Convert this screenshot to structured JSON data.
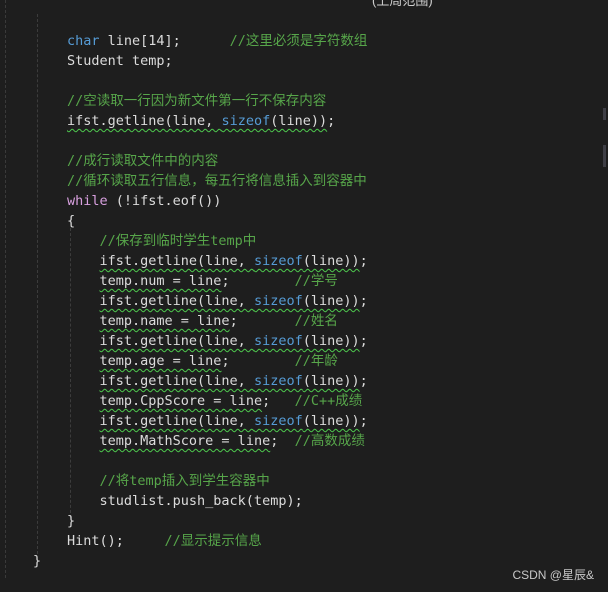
{
  "top_clipped_text": "(上周范围)",
  "code_lines": [
    {
      "t": [
        {
          "c": "kw",
          "s": "char"
        },
        {
          "c": "pl",
          "s": " line[14];      "
        },
        {
          "c": "cm",
          "s": "//这里必须是字符数组"
        }
      ]
    },
    {
      "t": [
        {
          "c": "pl",
          "s": "Student temp;"
        }
      ]
    },
    {
      "t": []
    },
    {
      "t": [
        {
          "c": "cm",
          "s": "//空读取一行因为新文件第一行不保存内容"
        }
      ]
    },
    {
      "t": [
        {
          "c": "pl sq",
          "s": "ifst.getline(line, "
        },
        {
          "c": "kw sq",
          "s": "sizeof"
        },
        {
          "c": "pl sq",
          "s": "(line))"
        },
        {
          "c": "pl",
          "s": ";"
        }
      ]
    },
    {
      "t": []
    },
    {
      "t": [
        {
          "c": "cm",
          "s": "//成行读取文件中的内容"
        }
      ]
    },
    {
      "t": [
        {
          "c": "cm",
          "s": "//循环读取五行信息，每五行将信息插入到容器中"
        }
      ]
    },
    {
      "t": [
        {
          "c": "kw2",
          "s": "while"
        },
        {
          "c": "pl",
          "s": " (!ifst.eof())"
        }
      ]
    },
    {
      "t": [
        {
          "c": "pl",
          "s": "{"
        }
      ]
    },
    {
      "t": [
        {
          "c": "cm",
          "s": "    //保存到临时学生temp中"
        }
      ]
    },
    {
      "t": [
        {
          "c": "pl",
          "s": "    "
        },
        {
          "c": "pl sq",
          "s": "ifst.getline(line, "
        },
        {
          "c": "kw sq",
          "s": "sizeof"
        },
        {
          "c": "pl sq",
          "s": "(line))"
        },
        {
          "c": "pl",
          "s": ";"
        }
      ]
    },
    {
      "t": [
        {
          "c": "pl",
          "s": "    "
        },
        {
          "c": "pl sq",
          "s": "temp.num = line"
        },
        {
          "c": "pl",
          "s": ";        "
        },
        {
          "c": "cm",
          "s": "//学号"
        }
      ]
    },
    {
      "t": [
        {
          "c": "pl",
          "s": "    "
        },
        {
          "c": "pl sq",
          "s": "ifst.getline(line, "
        },
        {
          "c": "kw sq",
          "s": "sizeof"
        },
        {
          "c": "pl sq",
          "s": "(line))"
        },
        {
          "c": "pl",
          "s": ";"
        }
      ]
    },
    {
      "t": [
        {
          "c": "pl",
          "s": "    "
        },
        {
          "c": "pl sq",
          "s": "temp.name = line"
        },
        {
          "c": "pl",
          "s": ";       "
        },
        {
          "c": "cm",
          "s": "//姓名"
        }
      ]
    },
    {
      "t": [
        {
          "c": "pl",
          "s": "    "
        },
        {
          "c": "pl sq",
          "s": "ifst.getline(line, "
        },
        {
          "c": "kw sq",
          "s": "sizeof"
        },
        {
          "c": "pl sq",
          "s": "(line))"
        },
        {
          "c": "pl",
          "s": ";"
        }
      ]
    },
    {
      "t": [
        {
          "c": "pl",
          "s": "    "
        },
        {
          "c": "pl sq",
          "s": "temp.age = line"
        },
        {
          "c": "pl",
          "s": ";        "
        },
        {
          "c": "cm",
          "s": "//年龄"
        }
      ]
    },
    {
      "t": [
        {
          "c": "pl",
          "s": "    "
        },
        {
          "c": "pl sq",
          "s": "ifst.getline(line, "
        },
        {
          "c": "kw sq",
          "s": "sizeof"
        },
        {
          "c": "pl sq",
          "s": "(line))"
        },
        {
          "c": "pl",
          "s": ";"
        }
      ]
    },
    {
      "t": [
        {
          "c": "pl",
          "s": "    "
        },
        {
          "c": "pl sq",
          "s": "temp.CppScore = line"
        },
        {
          "c": "pl",
          "s": ";   "
        },
        {
          "c": "cm",
          "s": "//C++成绩"
        }
      ]
    },
    {
      "t": [
        {
          "c": "pl",
          "s": "    "
        },
        {
          "c": "pl sq",
          "s": "ifst.getline(line, "
        },
        {
          "c": "kw sq",
          "s": "sizeof"
        },
        {
          "c": "pl sq",
          "s": "(line))"
        },
        {
          "c": "pl",
          "s": ";"
        }
      ]
    },
    {
      "t": [
        {
          "c": "pl",
          "s": "    "
        },
        {
          "c": "pl sq",
          "s": "temp.MathScore = line"
        },
        {
          "c": "pl",
          "s": ";  "
        },
        {
          "c": "cm",
          "s": "//高数成绩"
        }
      ]
    },
    {
      "t": []
    },
    {
      "t": [
        {
          "c": "cm",
          "s": "    //将temp插入到学生容器中"
        }
      ]
    },
    {
      "t": [
        {
          "c": "pl",
          "s": "    studlist.push_back(temp);"
        }
      ]
    },
    {
      "t": [
        {
          "c": "pl",
          "s": "}"
        }
      ]
    },
    {
      "t": [
        {
          "c": "pl",
          "s": "Hint();     "
        },
        {
          "c": "cm",
          "s": "//显示提示信息"
        }
      ]
    },
    {
      "t": [
        {
          "c": "pl",
          "s": "}"
        }
      ]
    }
  ],
  "watermark": "CSDN @星辰&"
}
